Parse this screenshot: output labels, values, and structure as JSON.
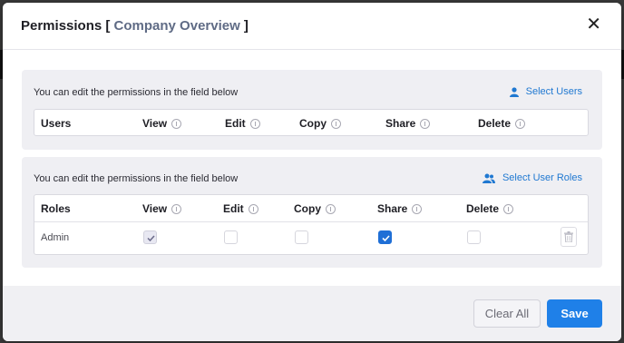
{
  "modal": {
    "title_prefix": "Permissions [ ",
    "title_entity": "Company Overview",
    "title_suffix": " ]",
    "close_glyph": "✕"
  },
  "users_panel": {
    "description": "You can edit the permissions in the field below",
    "link_label": "Select Users",
    "link_icon": "user-icon",
    "columns": [
      "Users",
      "View",
      "Edit",
      "Copy",
      "Share",
      "Delete"
    ]
  },
  "roles_panel": {
    "description": "You can edit the permissions in the field below",
    "link_label": "Select User Roles",
    "link_icon": "users-group-icon",
    "columns": [
      "Roles",
      "View",
      "Edit",
      "Copy",
      "Share",
      "Delete"
    ],
    "rows": [
      {
        "role": "Admin",
        "view": true,
        "edit": false,
        "copy": false,
        "share": true,
        "delete": false
      }
    ]
  },
  "footer": {
    "clear_label": "Clear All",
    "save_label": "Save"
  },
  "colors": {
    "accent": "#1f80e8",
    "link": "#1f78d1",
    "title_entity": "#5f6b85"
  }
}
